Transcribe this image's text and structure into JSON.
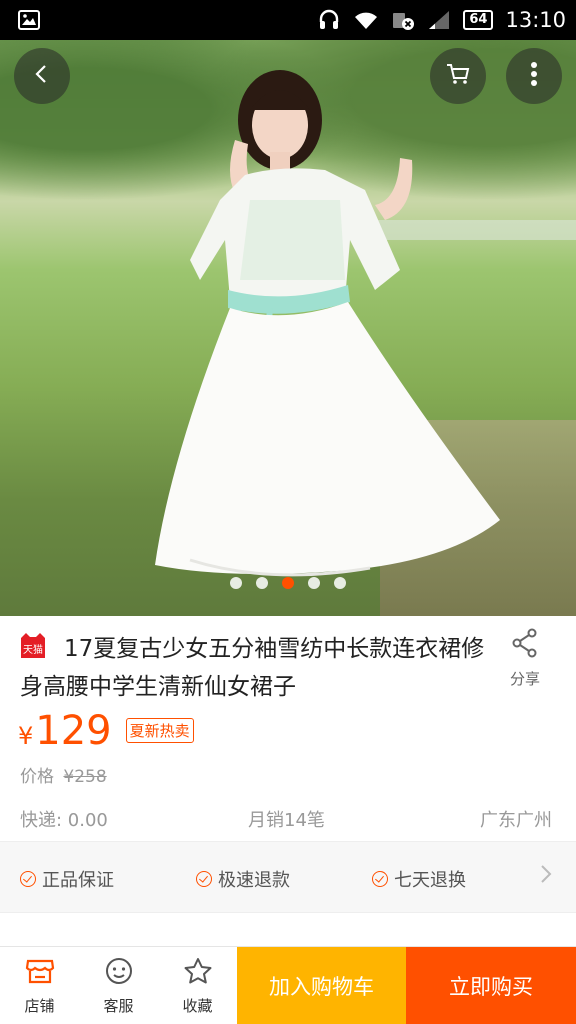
{
  "status_bar": {
    "battery": "64",
    "time": "13:10",
    "icons": [
      "gallery-icon",
      "headset-icon",
      "wifi-icon",
      "sim-blocked-icon",
      "signal-icon",
      "battery-icon"
    ]
  },
  "hero": {
    "back_icon": "back-arrow-icon",
    "cart_icon": "cart-icon",
    "more_icon": "more-vertical-icon",
    "image_count": 5,
    "active_index": 2
  },
  "product": {
    "badge_text": "天猫",
    "title": "17夏复古少女五分袖雪纺中长款连衣裙修身高腰中学生清新仙女裙子",
    "share_label": "分享",
    "price_symbol": "¥",
    "price": "129",
    "hot_tag": "夏新热卖",
    "original_label": "价格",
    "original_price": "¥258",
    "shipping": "快递: 0.00",
    "monthly_sales": "月销14笔",
    "location": "广东广州"
  },
  "guarantees": [
    "正品保证",
    "极速退款",
    "七天退换"
  ],
  "bottom_bar": {
    "store_label": "店铺",
    "service_label": "客服",
    "favorite_label": "收藏",
    "add_cart_label": "加入购物车",
    "buy_now_label": "立即购买"
  },
  "colors": {
    "accent": "#ff5000",
    "cart_button": "#ffb400"
  }
}
